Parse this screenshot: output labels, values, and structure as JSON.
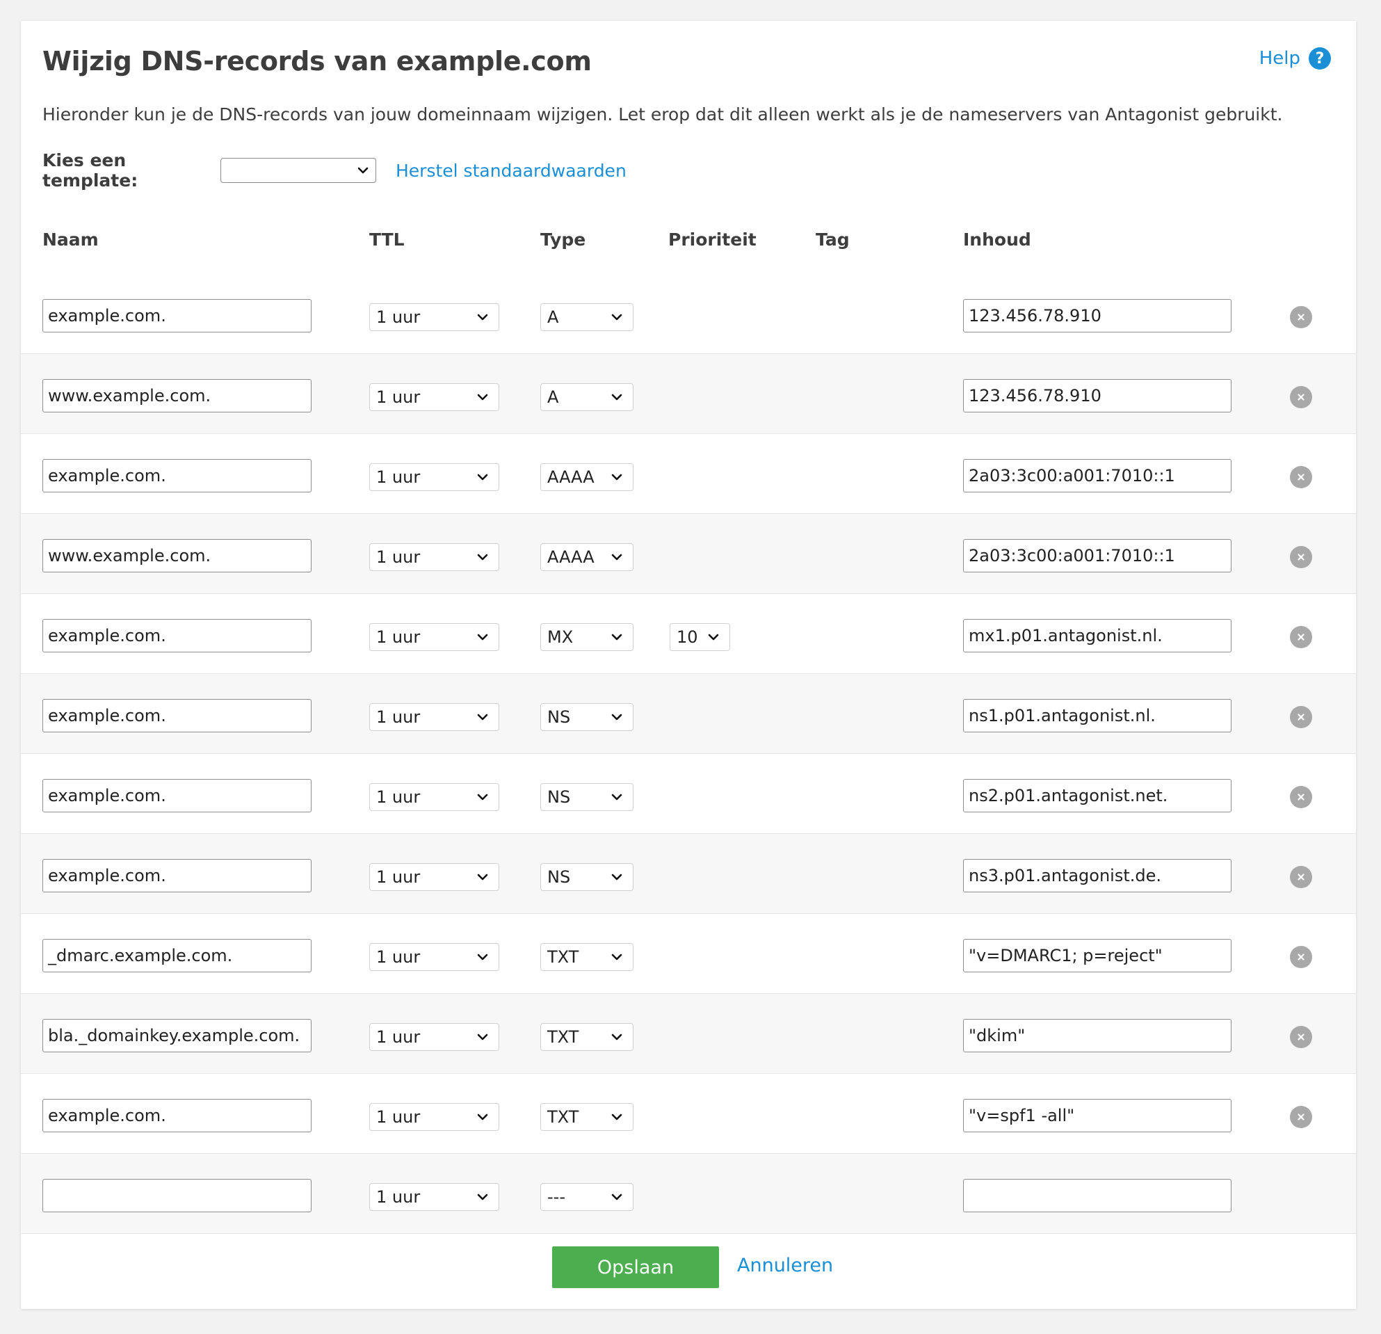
{
  "page": {
    "title": "Wijzig DNS-records van example.com",
    "help_label": "Help",
    "help_icon": "?",
    "intro": "Hieronder kun je de DNS-records van jouw domeinnaam wijzigen. Let erop dat dit alleen werkt als je de nameservers van Antagonist gebruikt.",
    "template_label": "Kies een template:",
    "template_value": "",
    "restore_link": "Herstel standaardwaarden"
  },
  "columns": {
    "naam": "Naam",
    "ttl": "TTL",
    "type": "Type",
    "prioriteit": "Prioriteit",
    "tag": "Tag",
    "inhoud": "Inhoud"
  },
  "records": [
    {
      "naam": "example.com.",
      "ttl": "1 uur",
      "type": "A",
      "prioriteit": null,
      "inhoud": "123.456.78.910"
    },
    {
      "naam": "www.example.com.",
      "ttl": "1 uur",
      "type": "A",
      "prioriteit": null,
      "inhoud": "123.456.78.910"
    },
    {
      "naam": "example.com.",
      "ttl": "1 uur",
      "type": "AAAA",
      "prioriteit": null,
      "inhoud": "2a03:3c00:a001:7010::1"
    },
    {
      "naam": "www.example.com.",
      "ttl": "1 uur",
      "type": "AAAA",
      "prioriteit": null,
      "inhoud": "2a03:3c00:a001:7010::1"
    },
    {
      "naam": "example.com.",
      "ttl": "1 uur",
      "type": "MX",
      "prioriteit": "10",
      "inhoud": "mx1.p01.antagonist.nl."
    },
    {
      "naam": "example.com.",
      "ttl": "1 uur",
      "type": "NS",
      "prioriteit": null,
      "inhoud": "ns1.p01.antagonist.nl."
    },
    {
      "naam": "example.com.",
      "ttl": "1 uur",
      "type": "NS",
      "prioriteit": null,
      "inhoud": "ns2.p01.antagonist.net."
    },
    {
      "naam": "example.com.",
      "ttl": "1 uur",
      "type": "NS",
      "prioriteit": null,
      "inhoud": "ns3.p01.antagonist.de."
    },
    {
      "naam": "_dmarc.example.com.",
      "ttl": "1 uur",
      "type": "TXT",
      "prioriteit": null,
      "inhoud": "\"v=DMARC1; p=reject\""
    },
    {
      "naam": "bla._domainkey.example.com.",
      "ttl": "1 uur",
      "type": "TXT",
      "prioriteit": null,
      "inhoud": "\"dkim\""
    },
    {
      "naam": "example.com.",
      "ttl": "1 uur",
      "type": "TXT",
      "prioriteit": null,
      "inhoud": "\"v=spf1 -all\""
    }
  ],
  "new_record": {
    "naam": "",
    "ttl": "1 uur",
    "type": "---",
    "inhoud": ""
  },
  "actions": {
    "save_label": "Opslaan",
    "cancel_label": "Annuleren"
  },
  "colors": {
    "accent": "#1a8fd6",
    "save_button": "#4cae4f",
    "delete_icon": "#a8a8a8",
    "row_alt": "#f7f7f7"
  },
  "icons": {
    "help": "question-circle-icon",
    "delete": "close-circle-icon",
    "dropdown": "chevron-down-icon"
  }
}
